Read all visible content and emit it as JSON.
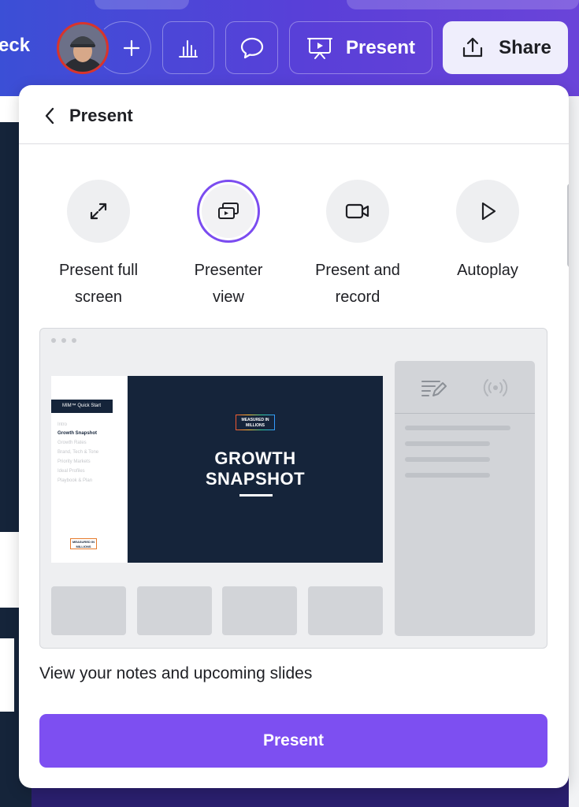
{
  "topbar": {
    "deck_label": "eck",
    "present_label": "Present",
    "share_label": "Share",
    "icons": [
      "add-icon",
      "analytics-icon",
      "comment-icon",
      "presentation-icon",
      "share-icon"
    ]
  },
  "panel": {
    "title": "Present",
    "options": [
      {
        "label": "Present full\nscreen",
        "icon": "expand-icon",
        "selected": false
      },
      {
        "label": "Presenter\nview",
        "icon": "presenter-view-icon",
        "selected": true
      },
      {
        "label": "Present and\nrecord",
        "icon": "video-camera-icon",
        "selected": false
      },
      {
        "label": "Autoplay",
        "icon": "play-icon",
        "selected": false
      }
    ],
    "preview": {
      "sidebar_title": "MIM™ Quick Start",
      "sidebar_items": [
        "Intro",
        "Growth Snapshot",
        "Growth Rates",
        "Brand, Tech & Tone",
        "Priority Markets",
        "Ideal Profiles",
        "Playbook & Plan"
      ],
      "sidebar_active": "Growth Snapshot",
      "logo_text": "MEASURED IN MILLIONS",
      "slide_title_line1": "GROWTH",
      "slide_title_line2": "SNAPSHOT"
    },
    "description": "View your notes and upcoming slides",
    "cta_label": "Present"
  },
  "colors": {
    "accent": "#7d4ff1",
    "slide_navy": "#15243a",
    "topbar_start": "#3b4fd6",
    "topbar_end": "#6a44d9"
  }
}
